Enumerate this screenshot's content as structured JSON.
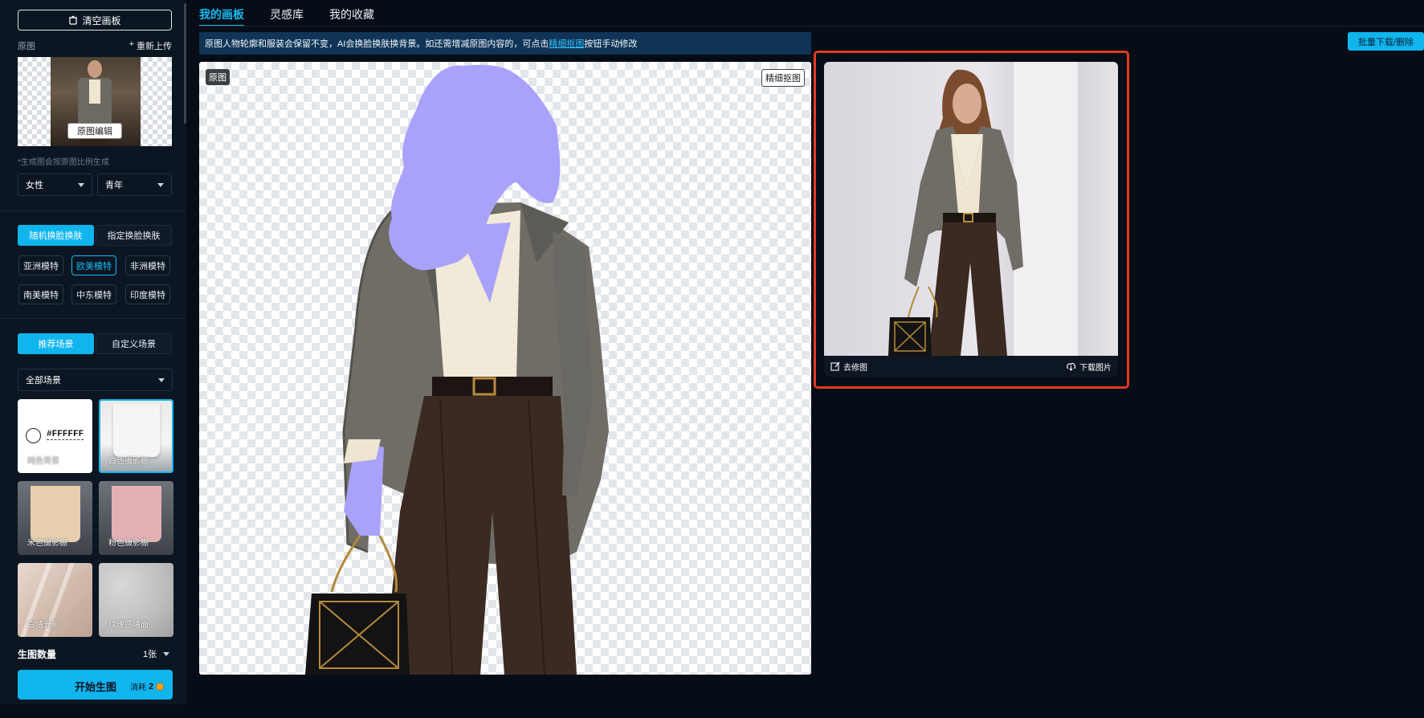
{
  "sidebar": {
    "clear_canvas": "清空画板",
    "original_label": "原图",
    "reupload": "重新上传",
    "reupload_plus": "+",
    "edit_original": "原图编辑",
    "ratio_hint": "*生成图会按原图比例生成",
    "gender_select": "女性",
    "age_select": "青年",
    "swap_modes": [
      "随机换脸换肤",
      "指定换脸换肤"
    ],
    "models": [
      "亚洲模特",
      "欧美模特",
      "非洲模特",
      "南美模特",
      "中东模特",
      "印度模特"
    ],
    "active_model": "欧美模特",
    "scene_modes": [
      "推荐场景",
      "自定义场景"
    ],
    "scene_filter": "全部场景",
    "solid_color_value": "#FFFFFF",
    "scenes": [
      "纯色背景",
      "白色摄影棚",
      "米色摄影棚",
      "粉色摄影棚",
      "白墙光影",
      "纹理感墙面"
    ],
    "gen_count_label": "生图数量",
    "gen_count_value": "1张",
    "start_button": "开始生图",
    "cost_label": "消耗",
    "cost_value": "2"
  },
  "tabs": [
    "我的画板",
    "灵感库",
    "我的收藏"
  ],
  "notice": {
    "before": "原图人物轮廓和服装会保留不变，AI会换脸换肤换背景。如还需增减原图内容的，可点击",
    "link": "精细抠图",
    "after": "按钮手动修改"
  },
  "batch_button": "批量下载/删除",
  "canvas": {
    "tag": "原图",
    "refine_button": "精细抠图"
  },
  "result": {
    "retouch": "去修图",
    "download": "下载图片"
  },
  "colors": {
    "accent": "#10b5ee",
    "mask": "#a9a2fb",
    "highlight_frame": "#e03a22"
  }
}
